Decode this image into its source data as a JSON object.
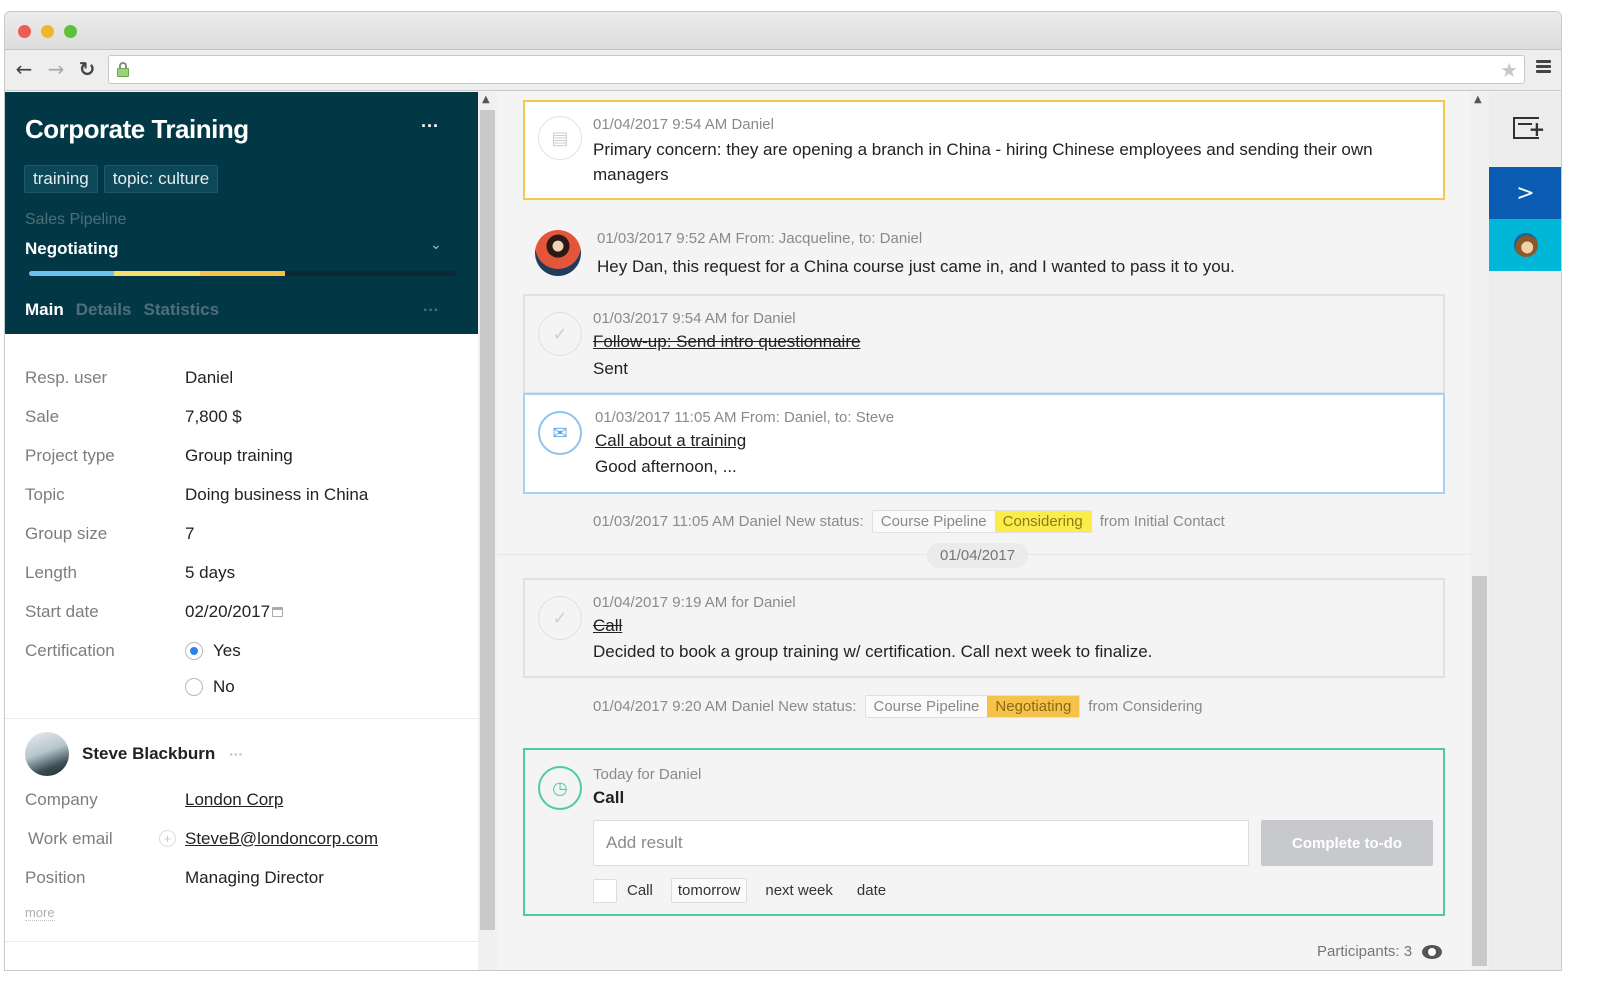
{
  "browser": {
    "url": "",
    "icons": {
      "back": "arrow-left-icon",
      "forward": "arrow-right-icon",
      "reload": "reload-icon",
      "lock": "lock-icon",
      "bookmark": "star-icon",
      "menu": "hamburger-menu-icon"
    }
  },
  "deal": {
    "title": "Corporate Training",
    "tags": [
      "training",
      "topic: culture"
    ],
    "pipeline_label": "Sales Pipeline",
    "stage": "Negotiating",
    "pipeline_progress": {
      "stages_completed": 3,
      "stages_total": 5,
      "colors": [
        "#6ec2ef",
        "#f6e06b",
        "#f5c04a"
      ]
    },
    "tabs": [
      {
        "label": "Main",
        "active": true
      },
      {
        "label": "Details",
        "active": false
      },
      {
        "label": "Statistics",
        "active": false
      }
    ],
    "more_label": "···",
    "fields": [
      {
        "label": "Resp. user",
        "value": "Daniel"
      },
      {
        "label": "Sale",
        "value": "7,800 $"
      },
      {
        "label": "Project type",
        "value": "Group training"
      },
      {
        "label": "Topic",
        "value": "Doing business in China"
      },
      {
        "label": "Group size",
        "value": "7"
      },
      {
        "label": "Length",
        "value": "5 days"
      },
      {
        "label": "Start date",
        "value": "02/20/2017"
      }
    ],
    "certification": {
      "label": "Certification",
      "options": [
        {
          "label": "Yes",
          "checked": true
        },
        {
          "label": "No",
          "checked": false
        }
      ]
    }
  },
  "contact": {
    "name": "Steve Blackburn",
    "more_label": "···",
    "company_label": "Company",
    "company": "London Corp",
    "email_label": "Work email",
    "email": "SteveB@londoncorp.com",
    "position_label": "Position",
    "position": "Managing Director",
    "more_link": "more"
  },
  "feed": {
    "note": {
      "meta": "01/04/2017 9:54 AM Daniel",
      "text": "Primary concern: they are opening a branch in China - hiring Chinese employees and sending their own managers"
    },
    "message": {
      "meta": "01/03/2017 9:52 AM From: Jacqueline, to: Daniel",
      "text": "Hey Dan, this request for a China course just came in, and I wanted to pass it to you."
    },
    "task1": {
      "meta": "01/03/2017 9:54 AM for Daniel",
      "title": "Follow-up: Send intro questionnaire",
      "result": "Sent"
    },
    "email": {
      "meta": "01/03/2017 11:05 AM From: Daniel, to: Steve",
      "subject": "Call about a training",
      "preview": "Good afternoon, ..."
    },
    "status1": {
      "meta": "01/03/2017 11:05 AM Daniel New status:",
      "pipeline": "Course Pipeline",
      "status": "Considering",
      "status_color": "#fbec4a",
      "from": "from Initial Contact"
    },
    "date_separator": "01/04/2017",
    "task2": {
      "meta": "01/04/2017 9:19 AM for Daniel",
      "title": "Call",
      "result": "Decided to book a group training w/ certification. Call next week to finalize."
    },
    "status2": {
      "meta": "01/04/2017 9:20 AM Daniel New status:",
      "pipeline": "Course Pipeline",
      "status": "Negotiating",
      "status_color": "#f7c24a",
      "from": "from Considering"
    },
    "todo": {
      "meta": "Today for Daniel",
      "title": "Call",
      "input_placeholder": "Add result",
      "input_value": "",
      "complete_button": "Complete to-do",
      "followup_label": "Call",
      "options": [
        "tomorrow",
        "next week",
        "date"
      ],
      "selected_option": "tomorrow"
    },
    "participants": "Participants: 3"
  },
  "right_rail": {
    "items": [
      {
        "name": "add-panel",
        "icon": "add-window-icon"
      },
      {
        "name": "activecampaign",
        "icon": "chevron-right-icon",
        "color": "#0a5cb3"
      },
      {
        "name": "mailchimp",
        "icon": "mailchimp-icon",
        "color": "#00b7d8"
      }
    ]
  }
}
